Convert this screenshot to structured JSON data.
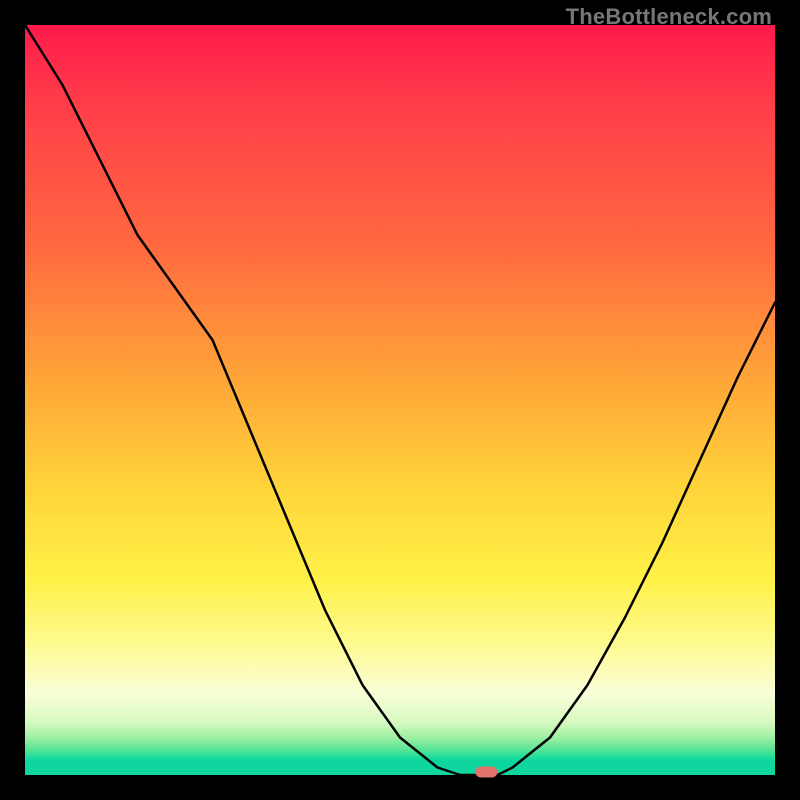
{
  "watermark": "TheBottleneck.com",
  "chart_data": {
    "type": "line",
    "title": "",
    "xlabel": "",
    "ylabel": "",
    "x": [
      0.0,
      0.05,
      0.1,
      0.15,
      0.2,
      0.25,
      0.3,
      0.35,
      0.4,
      0.45,
      0.5,
      0.55,
      0.58,
      0.6,
      0.63,
      0.65,
      0.7,
      0.75,
      0.8,
      0.85,
      0.9,
      0.95,
      1.0
    ],
    "y": [
      1.0,
      0.92,
      0.82,
      0.72,
      0.65,
      0.58,
      0.46,
      0.34,
      0.22,
      0.12,
      0.05,
      0.01,
      0.0,
      0.0,
      0.0,
      0.01,
      0.05,
      0.12,
      0.21,
      0.31,
      0.42,
      0.53,
      0.63
    ],
    "xlim": [
      0,
      1
    ],
    "ylim": [
      0,
      1
    ],
    "marker_x": 0.615,
    "marker_y": 0.0,
    "background": "heatmap-gradient-red-to-green"
  },
  "colors": {
    "curve": "#000000",
    "marker": "#e2746b",
    "frame": "#000000"
  }
}
